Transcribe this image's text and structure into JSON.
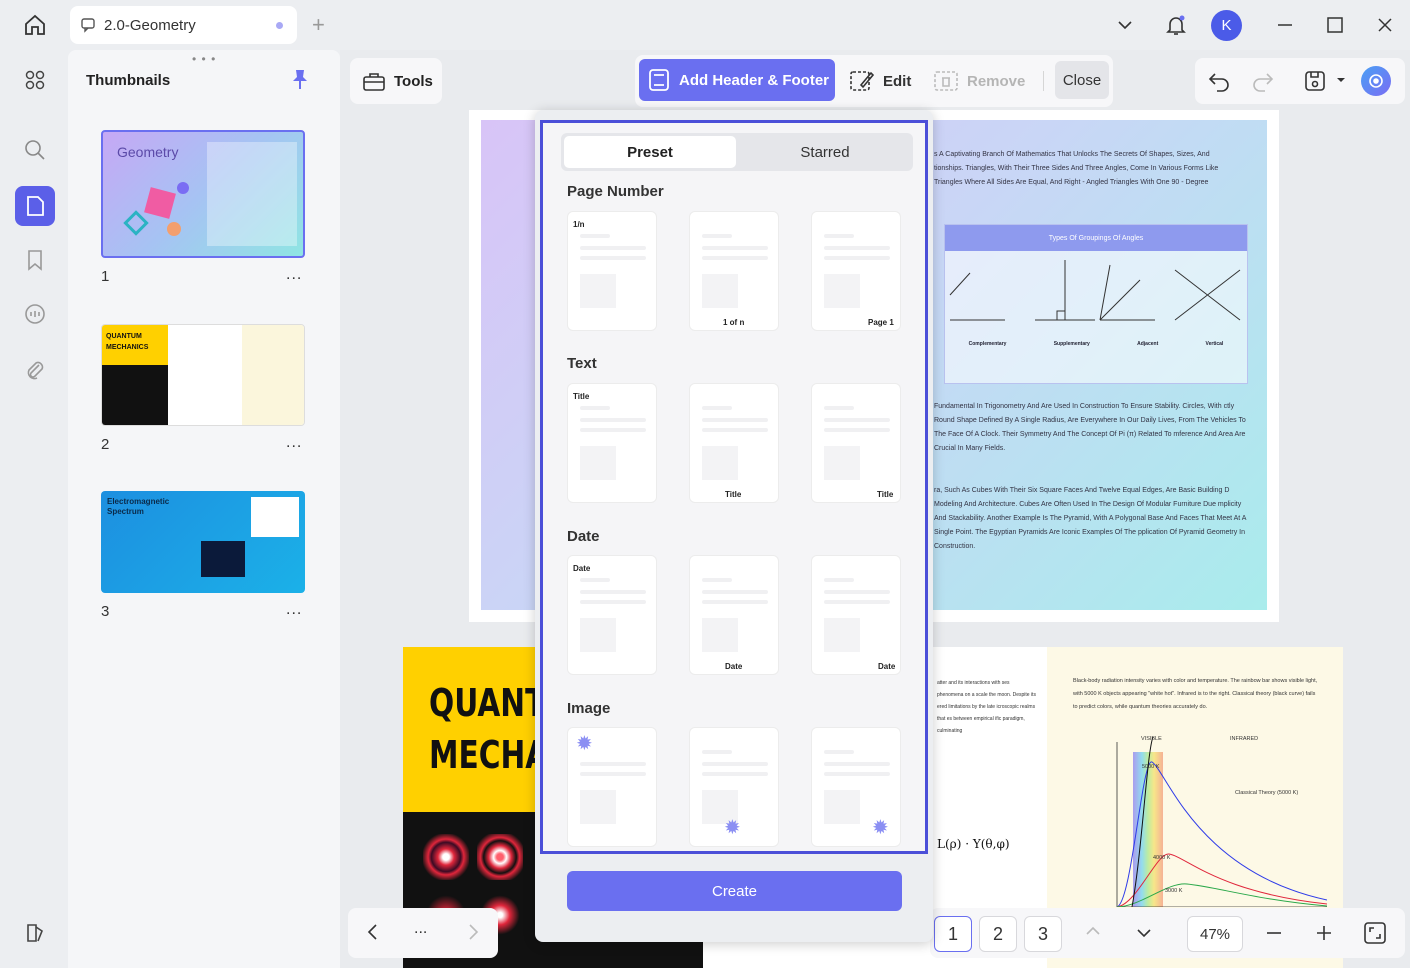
{
  "titlebar": {
    "tab_title": "2.0-Geometry",
    "avatar_letter": "K"
  },
  "thumbnails": {
    "title": "Thumbnails",
    "pages": [
      {
        "num": "1",
        "label": "Geometry"
      },
      {
        "num": "2",
        "label": "QUANTUM MECHANICS"
      },
      {
        "num": "3",
        "label": "Electromagnetic Spectrum"
      }
    ],
    "more": "..."
  },
  "toolbar": {
    "tools_label": "Tools",
    "add_header_footer": "Add Header & Footer",
    "edit": "Edit",
    "remove": "Remove",
    "close": "Close"
  },
  "modal": {
    "tabs": {
      "preset": "Preset",
      "starred": "Starred"
    },
    "sections": {
      "page_number": "Page Number",
      "text": "Text",
      "date": "Date",
      "image": "Image"
    },
    "cards": {
      "pn1": "1/n",
      "pn2": "1 of n",
      "pn3": "Page 1",
      "t1": "Title",
      "t2": "Title",
      "t3": "Title",
      "d1": "Date",
      "d2": "Date",
      "d3": "Date"
    },
    "create": "Create"
  },
  "document": {
    "page1": {
      "line1": "s A Captivating Branch Of Mathematics That Unlocks The Secrets Of Shapes, Sizes, And",
      "line2": "tionships. Triangles, With Their Three Sides And Three Angles, Come In Various Forms Like",
      "line3": "Triangles Where All Sides Are Equal, And Right - Angled Triangles With One 90 - Degree",
      "box_title": "Types Of Groupings Of Angles",
      "angles": [
        "Complementary",
        "Supplementary",
        "Adjacent",
        "Vertical"
      ],
      "para2": "Fundamental In Trigonometry And Are Used In Construction To Ensure Stability. Circles, With ctly Round Shape Defined By A Single Radius, Are Everywhere In Our Daily Lives, From The Vehicles To The Face Of A Clock. Their Symmetry And The Concept Of Pi (π) Related To mference And Area Are Crucial In Many Fields.",
      "para3": "ra, Such As Cubes With Their Six Square Faces And Twelve Equal Edges, Are Basic Building D Modeling And Architecture. Cubes Are Often Used In The Design Of Modular Furniture Due mplicity And Stackability. Another Example Is The Pyramid, With A Polygonal Base And Faces That Meet At A Single Point. The Egyptian Pyramids Are Iconic Examples Of The pplication Of Pyramid Geometry In Construction."
    },
    "page2": {
      "title_line1": "QUANTU",
      "title_line2": "MECHA",
      "right_text": "Black-body radiation intensity varies with color and temperature. The rainbow bar shows visible light, with 5000 K objects appearing \"white hot\". Infrared is to the right. Classical theory (black curve) fails to predict colors, while quantum theories accurately do.",
      "visible": "VISIBLE",
      "infrared": "INFRARED",
      "classical": "Classical Theory (5000 K)",
      "k5000": "5000 K",
      "k4000": "4000 K",
      "k3000": "3000 K"
    }
  },
  "bottom_nav": {
    "ellipsis": "...",
    "pages": [
      "1",
      "2",
      "3"
    ],
    "zoom": "47%"
  }
}
